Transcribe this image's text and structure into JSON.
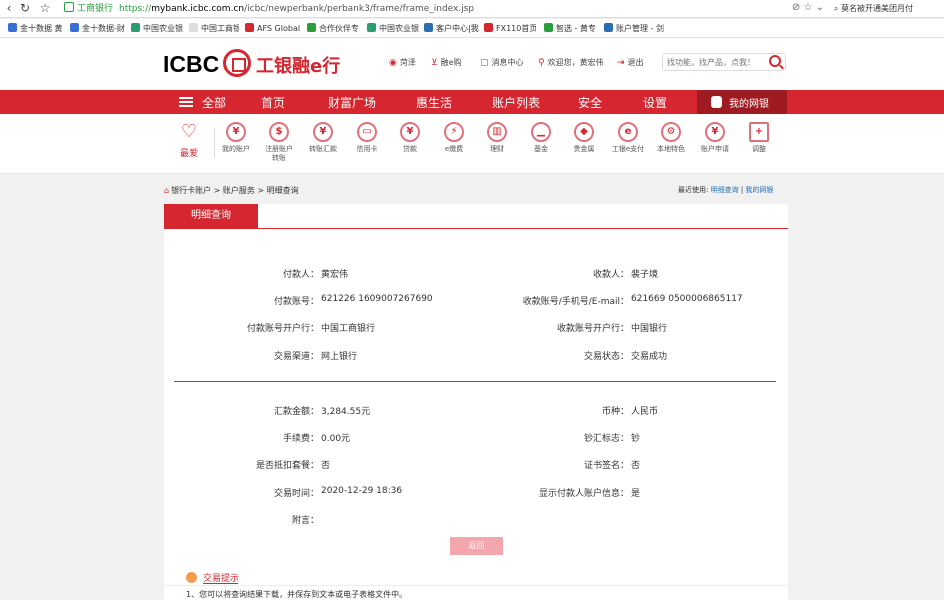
{
  "browser": {
    "site_label": "工商银行",
    "url_protocol": "https://",
    "url_host": "mybank.icbc.com.cn",
    "url_path": "/icbc/newperbank/perbank3/frame/frame_index.jsp",
    "search_text": "莫名被开通美团月付",
    "bookmarks": [
      "金十数据 黄",
      "金十数据-财",
      "中国农业银",
      "中国工商银",
      "AFS Global",
      "合作伙伴专",
      "中国农业银",
      "客户中心|我",
      "FX110首页",
      "智选 - 黄专",
      "账户管理 - 剑"
    ]
  },
  "header": {
    "logo_text": "ICBC",
    "logo_cn": "工银融e行",
    "links": [
      {
        "icon": "location-pin-icon",
        "label": "菏泽"
      },
      {
        "icon": "cart-icon",
        "label": "融e购"
      },
      {
        "icon": "message-icon",
        "label": "消息中心"
      },
      {
        "icon": "user-icon",
        "label": "欢迎您，黄宏伟"
      },
      {
        "icon": "logout-icon",
        "label": "退出"
      }
    ],
    "search_placeholder": "找功能，找产品，点我！"
  },
  "main_nav": {
    "all_label": "全部",
    "items": [
      "首页",
      "财富广场",
      "惠生活",
      "账户列表",
      "安全",
      "设置"
    ],
    "mybank_label": "我的网银"
  },
  "quick_icons": {
    "favorite_label": "最爱",
    "items": [
      {
        "glyph": "¥",
        "label": "我的账户"
      },
      {
        "glyph": "$",
        "label": "注册账户转账"
      },
      {
        "glyph": "¥",
        "label": "转账汇款"
      },
      {
        "glyph": "▭",
        "label": "信用卡"
      },
      {
        "glyph": "¥",
        "label": "贷款"
      },
      {
        "glyph": "⚡",
        "label": "e缴费"
      },
      {
        "glyph": "▥",
        "label": "理财"
      },
      {
        "glyph": "▁",
        "label": "基金"
      },
      {
        "glyph": "◆",
        "label": "贵金属"
      },
      {
        "glyph": "e",
        "label": "工银e支付"
      },
      {
        "glyph": "⚙",
        "label": "本地特色"
      },
      {
        "glyph": "¥",
        "label": "账户申请"
      },
      {
        "glyph": "+",
        "label": "调整"
      }
    ]
  },
  "breadcrumb": {
    "text": "银行卡账户 > 账户服务 > 明细查询",
    "recent_label": "最近使用:",
    "recent_links": [
      "明细查询",
      "我的网银"
    ],
    "recent_sep": "|"
  },
  "detail": {
    "tab_label": "明细查询",
    "left_fields": [
      {
        "label": "付款人：",
        "value": "黄宏伟"
      },
      {
        "label": "付款账号：",
        "value": "621226 1609007267690"
      },
      {
        "label": "付款账号开户行：",
        "value": "中国工商银行"
      },
      {
        "label": "交易渠道：",
        "value": "网上银行"
      }
    ],
    "right_fields": [
      {
        "label": "收款人：",
        "value": "裴子境"
      },
      {
        "label": "收款账号/手机号/E-mail：",
        "value": "621669 0500006865117"
      },
      {
        "label": "收款账号开户行：",
        "value": "中国银行"
      },
      {
        "label": "交易状态：",
        "value": "交易成功"
      }
    ],
    "left_fields2": [
      {
        "label": "汇款金额：",
        "value": "3,284.55元"
      },
      {
        "label": "手续费：",
        "value": "0.00元"
      },
      {
        "label": "是否抵扣套餐：",
        "value": "否"
      },
      {
        "label": "交易时间：",
        "value": "2020-12-29 18:36"
      },
      {
        "label": "附言：",
        "value": ""
      }
    ],
    "right_fields2": [
      {
        "label": "币种：",
        "value": "人民币"
      },
      {
        "label": "钞汇标志：",
        "value": "钞"
      },
      {
        "label": "证书签名：",
        "value": "否"
      },
      {
        "label": "显示付款人账户信息：",
        "value": "是"
      }
    ],
    "back_label": "返回",
    "tips_title": "交易提示",
    "tip1": "1、您可以将查询结果下载，并保存到文本或电子表格文件中。"
  }
}
